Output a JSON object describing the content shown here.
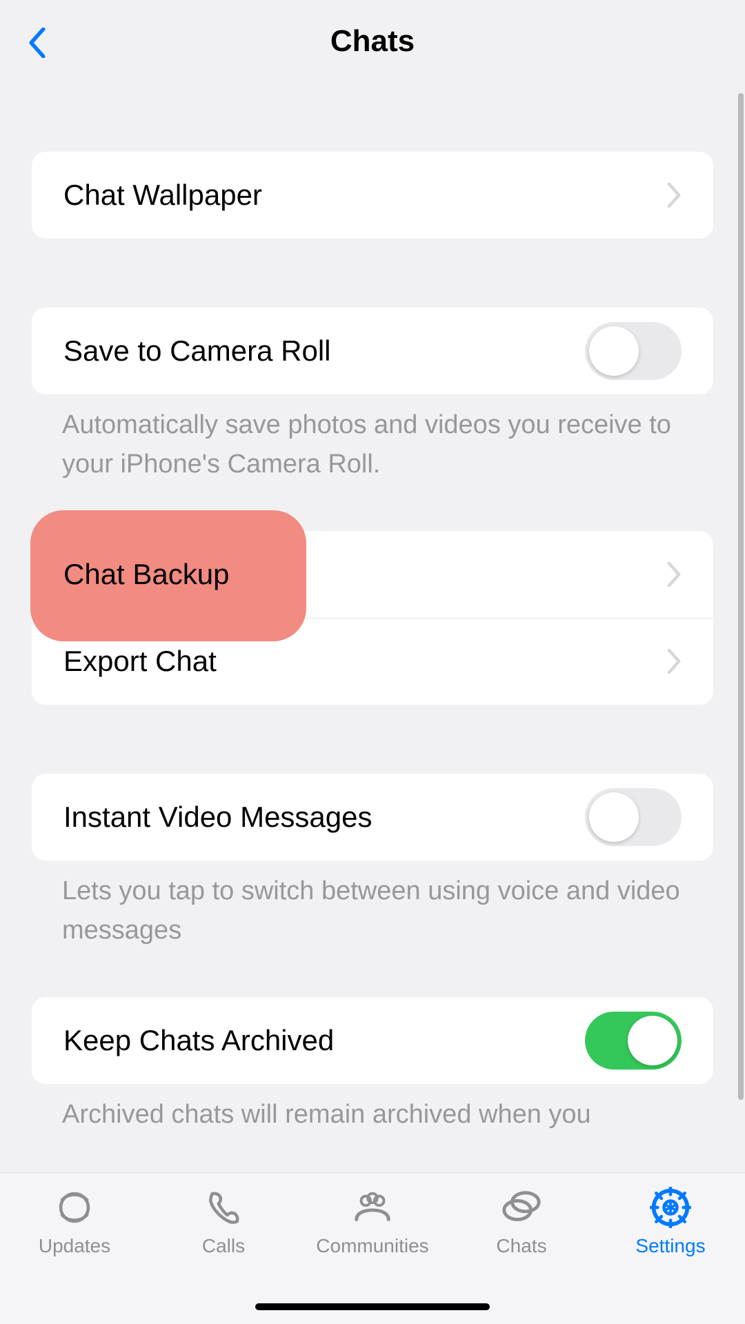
{
  "header": {
    "title": "Chats"
  },
  "sections": {
    "wallpaper": {
      "label": "Chat Wallpaper"
    },
    "camera_roll": {
      "label": "Save to Camera Roll",
      "footer": "Automatically save photos and videos you receive to your iPhone's Camera Roll.",
      "on": false
    },
    "backup": {
      "label": "Chat Backup"
    },
    "export": {
      "label": "Export Chat"
    },
    "instant_video": {
      "label": "Instant Video Messages",
      "footer": "Lets you tap to switch between using voice and video messages",
      "on": false
    },
    "keep_archived": {
      "label": "Keep Chats Archived",
      "footer": "Archived chats will remain archived when you",
      "on": true
    }
  },
  "tabs": {
    "updates": "Updates",
    "calls": "Calls",
    "communities": "Communities",
    "chats": "Chats",
    "settings": "Settings"
  }
}
